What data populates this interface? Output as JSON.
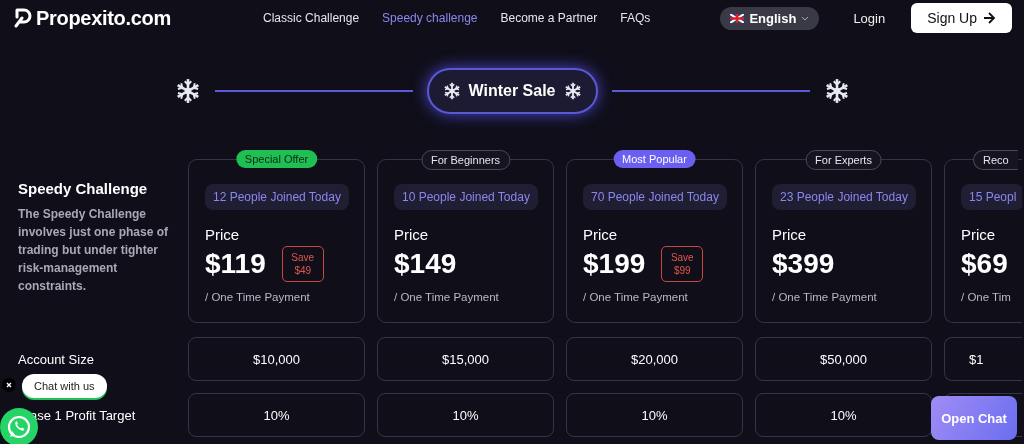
{
  "header": {
    "logo": "Propexito.com",
    "nav": [
      {
        "label": "Classic Challenge",
        "selected": false
      },
      {
        "label": "Speedy challenge",
        "selected": true
      },
      {
        "label": "Become a Partner",
        "selected": false
      },
      {
        "label": "FAQs",
        "selected": false
      }
    ],
    "language": "English",
    "login": "Login",
    "signup": "Sign Up"
  },
  "banner": {
    "title": "Winter Sale"
  },
  "intro": {
    "title": "Speedy Challenge",
    "description": "The Speedy Challenge involves just one phase of trading but under tighter risk-management constraints."
  },
  "plans": [
    {
      "badge": "Special Offer",
      "kind": "offer",
      "joined": "12 People Joined Today",
      "price_label": "Price",
      "price": "$119",
      "save": "Save $49",
      "payment": "/ One Time Payment"
    },
    {
      "badge": "For Beginners",
      "kind": "plain",
      "joined": "10 People Joined Today",
      "price_label": "Price",
      "price": "$149",
      "payment": "/ One Time Payment"
    },
    {
      "badge": "Most Popular",
      "kind": "popular",
      "joined": "70 People Joined Today",
      "price_label": "Price",
      "price": "$199",
      "save": "Save $99",
      "payment": "/ One Time Payment"
    },
    {
      "badge": "For Experts",
      "kind": "plain",
      "joined": "23 People Joined Today",
      "price_label": "Price",
      "price": "$399",
      "payment": "/ One Time Payment"
    },
    {
      "badge": "Reco",
      "kind": "plain",
      "joined": "15 Peopl",
      "price_label": "Price",
      "price": "$69",
      "payment": "/ One Tim"
    }
  ],
  "rows": [
    {
      "label": "Account Size",
      "values": [
        "$10,000",
        "$15,000",
        "$20,000",
        "$50,000",
        "$1"
      ]
    },
    {
      "label": "ase 1 Profit Target",
      "values": [
        "10%",
        "10%",
        "10%",
        "10%"
      ]
    }
  ],
  "chat": {
    "bubble": "Chat with us",
    "open_chat": "Open Chat"
  }
}
